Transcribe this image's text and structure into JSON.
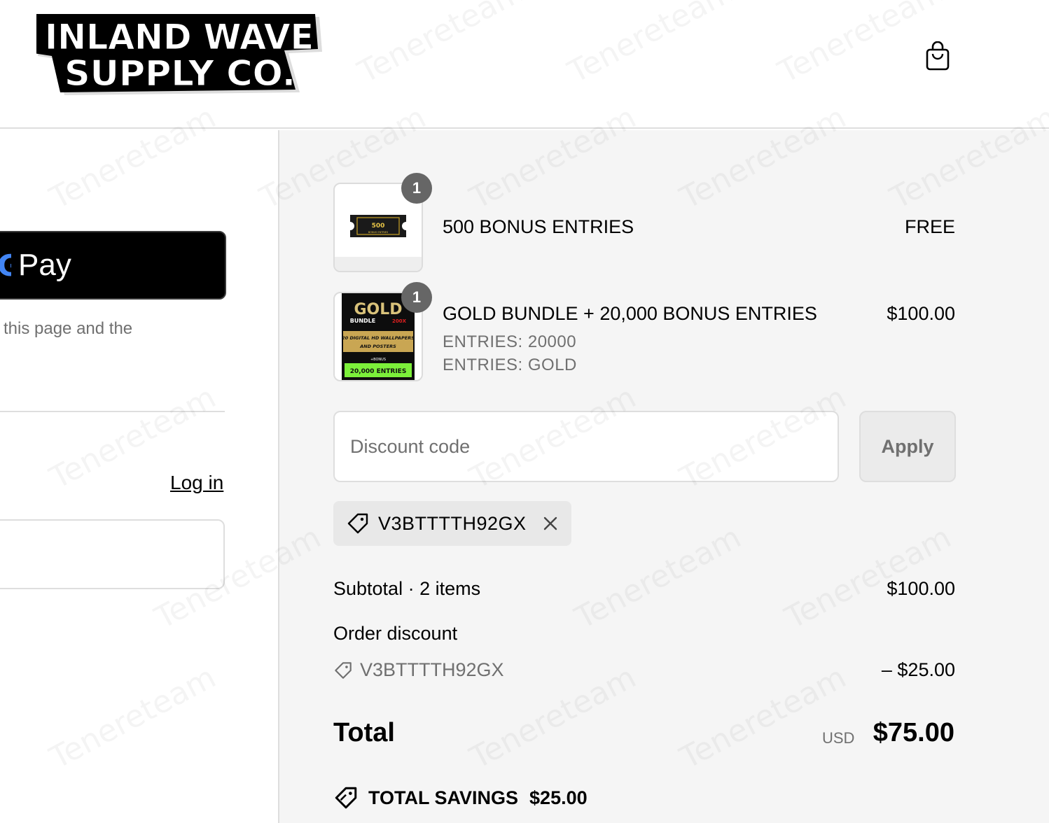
{
  "header": {
    "logo_line1": "INLAND WAVE",
    "logo_line2": "SUPPLY CO.",
    "cart_icon": "shopping-bag-icon"
  },
  "express_checkout": {
    "gpay_g": "G",
    "gpay_label": "Pay",
    "disclaimer": "this page and the"
  },
  "contact": {
    "login_link": "Log in"
  },
  "order": {
    "items": [
      {
        "quantity": "1",
        "title": "500 BONUS ENTRIES",
        "price": "FREE",
        "thumb_text": "500",
        "thumb_sub": "BONUS ENTRIES"
      },
      {
        "quantity": "1",
        "title": "GOLD BUNDLE + 20,000 BONUS ENTRIES",
        "price": "$100.00",
        "meta": [
          "ENTRIES: 20000",
          "ENTRIES: GOLD"
        ],
        "thumb_title": "GOLD",
        "thumb_bundle": "BUNDLE",
        "thumb_tag": "200X",
        "thumb_desc1": "20 DIGITAL HD WALLPAPERS",
        "thumb_desc2": "AND POSTERS",
        "thumb_bonus": "+BONUS",
        "thumb_entries": "20,000 ENTRIES"
      }
    ],
    "discount": {
      "placeholder": "Discount code",
      "apply_label": "Apply",
      "applied_code": "V3BTTTTH92GX"
    },
    "summary": {
      "subtotal_label": "Subtotal · 2 items",
      "subtotal_value": "$100.00",
      "order_discount_label": "Order discount",
      "discount_code": "V3BTTTTH92GX",
      "discount_value": "– $25.00",
      "total_label": "Total",
      "currency": "USD",
      "total_value": "$75.00",
      "savings_label": "TOTAL SAVINGS",
      "savings_value": "$25.00"
    }
  },
  "watermark_text": "Tenereteam"
}
